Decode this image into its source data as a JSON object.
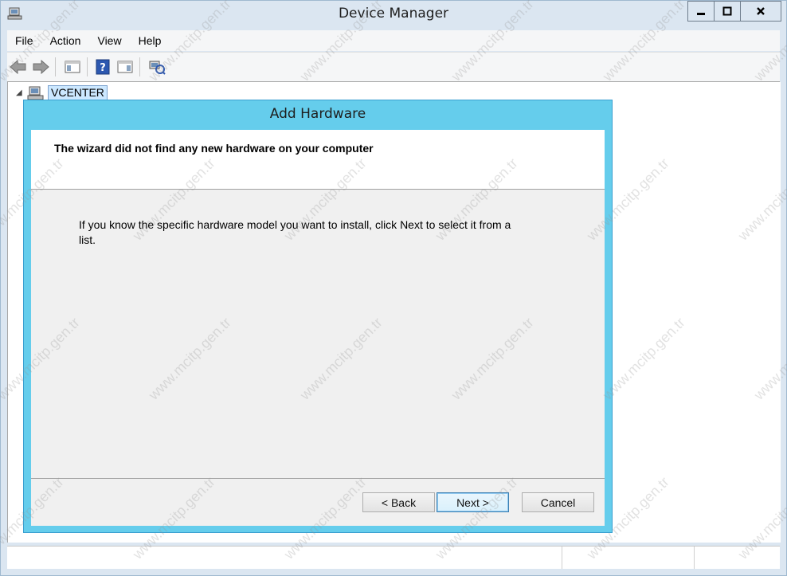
{
  "window": {
    "title": "Device Manager"
  },
  "menu": [
    "File",
    "Action",
    "View",
    "Help"
  ],
  "tree": {
    "root_label": "VCENTER"
  },
  "dialog": {
    "title": "Add Hardware",
    "heading": "The wizard did not find any new hardware on your computer",
    "body_line1": "If you know the specific hardware model you want to install, click Next to select it from a",
    "body_line2": "list.",
    "back_label": "< Back",
    "next_label": "Next >",
    "cancel_label": "Cancel"
  },
  "watermark": "www.mcitp.gen.tr",
  "colors": {
    "dialog_frame": "#65cdec",
    "window_frame": "#dbe6f1"
  }
}
